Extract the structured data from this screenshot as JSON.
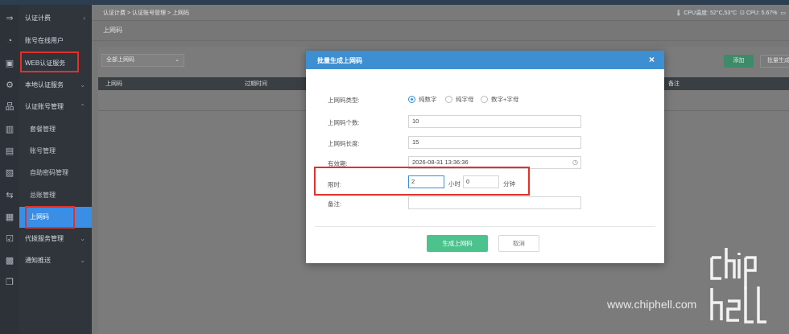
{
  "sidebar": {
    "items": [
      {
        "label": "认证计费"
      },
      {
        "label": "账号在线用户"
      },
      {
        "label": "WEB认证服务"
      },
      {
        "label": "本地认证服务"
      },
      {
        "label": "认证账号管理"
      },
      {
        "label": "套餐管理"
      },
      {
        "label": "账号管理"
      },
      {
        "label": "自助密码管理"
      },
      {
        "label": "总账管理"
      },
      {
        "label": "上网码"
      },
      {
        "label": "代拨服务管理"
      },
      {
        "label": "通知推送"
      }
    ]
  },
  "breadcrumb": "认证计费 > 认证账号管理 > 上网码",
  "status": {
    "cpu_temp": "CPU温度: 52°C,53°C",
    "cpu_usage": "CPU: 5.67%"
  },
  "page_title": "上网码",
  "filter": {
    "selected": "全部上网码"
  },
  "toolbar": {
    "add": "添加",
    "batch": "批量生成"
  },
  "table": {
    "headers": [
      "上网码",
      "过期时间",
      "备注"
    ]
  },
  "modal": {
    "title": "批量生成上网码",
    "close": "×",
    "fields": {
      "type_label": "上网码类型:",
      "type_options": [
        "纯数字",
        "纯字母",
        "数字+字母"
      ],
      "type_selected": "纯数字",
      "count_label": "上网码个数:",
      "count_value": "10",
      "length_label": "上网码长度:",
      "length_value": "15",
      "expire_label": "有效期:",
      "expire_value": "2026-08-31 13:36:36",
      "limit_label": "限时:",
      "limit_hours": "2",
      "hours_unit": "小时",
      "limit_minutes": "0",
      "minutes_unit": "分钟",
      "note_label": "备注:",
      "note_value": ""
    },
    "generate_button": "生成上网码",
    "cancel_button": "取消"
  },
  "watermark": {
    "text": "www.chiphell.com",
    "logo": "chip hell"
  },
  "colors": {
    "accent": "#3e8fd1",
    "green": "#4cc28d",
    "highlight": "#e0322b"
  }
}
